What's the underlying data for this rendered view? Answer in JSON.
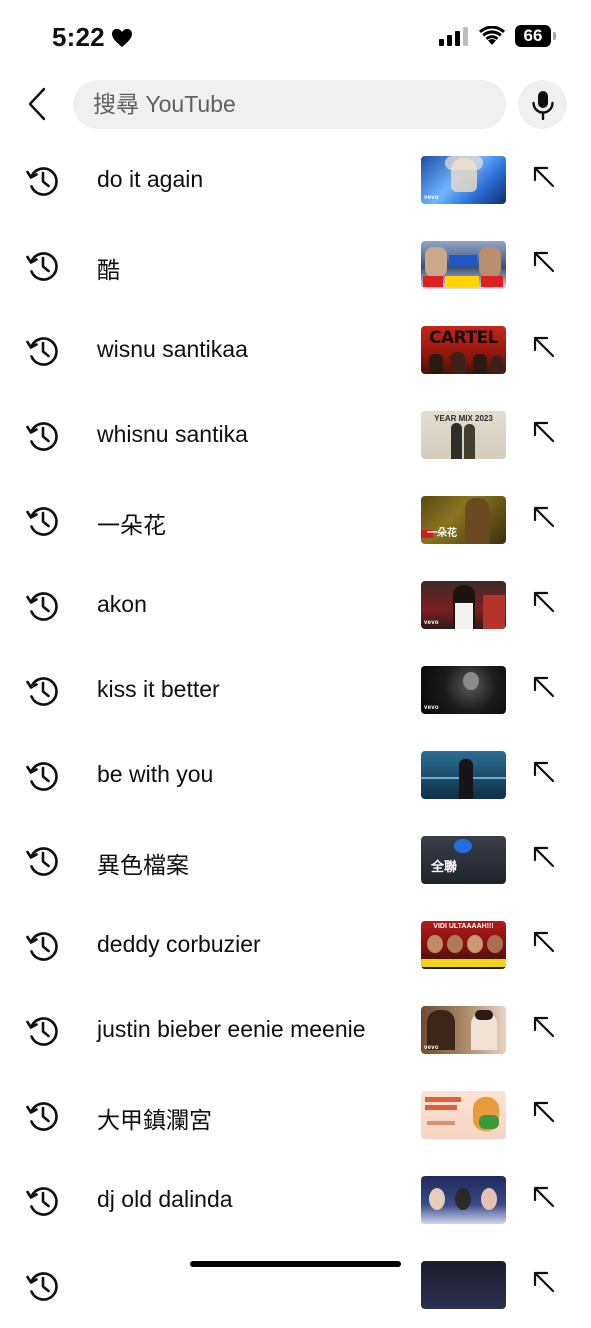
{
  "status_bar": {
    "time": "5:22",
    "battery": "66"
  },
  "search": {
    "placeholder": "搜尋 YouTube"
  },
  "suggestions": [
    {
      "text": "do it again",
      "thumb_label": "vevo"
    },
    {
      "text": "酷",
      "thumb_label": ""
    },
    {
      "text": "wisnu santikaa",
      "thumb_label": "CARTEL"
    },
    {
      "text": "whisnu santika",
      "thumb_label": "YEAR MIX 2023"
    },
    {
      "text": "一朵花",
      "thumb_label": "一朵花"
    },
    {
      "text": "akon",
      "thumb_label": "vevo"
    },
    {
      "text": "kiss it better",
      "thumb_label": "vevo"
    },
    {
      "text": "be with you",
      "thumb_label": ""
    },
    {
      "text": "異色檔案",
      "thumb_label": "全聯"
    },
    {
      "text": "deddy corbuzier",
      "thumb_label": "VIDI ULTAAAAH!!!"
    },
    {
      "text": "justin bieber eenie meenie",
      "thumb_label": "vevo"
    },
    {
      "text": "大甲鎮瀾宮",
      "thumb_label": ""
    },
    {
      "text": "dj old dalinda",
      "thumb_label": ""
    },
    {
      "text": "",
      "thumb_label": ""
    }
  ],
  "colors": {
    "text": "#0f0f0f",
    "search_bg": "#f0f0f0",
    "placeholder": "#606060"
  }
}
